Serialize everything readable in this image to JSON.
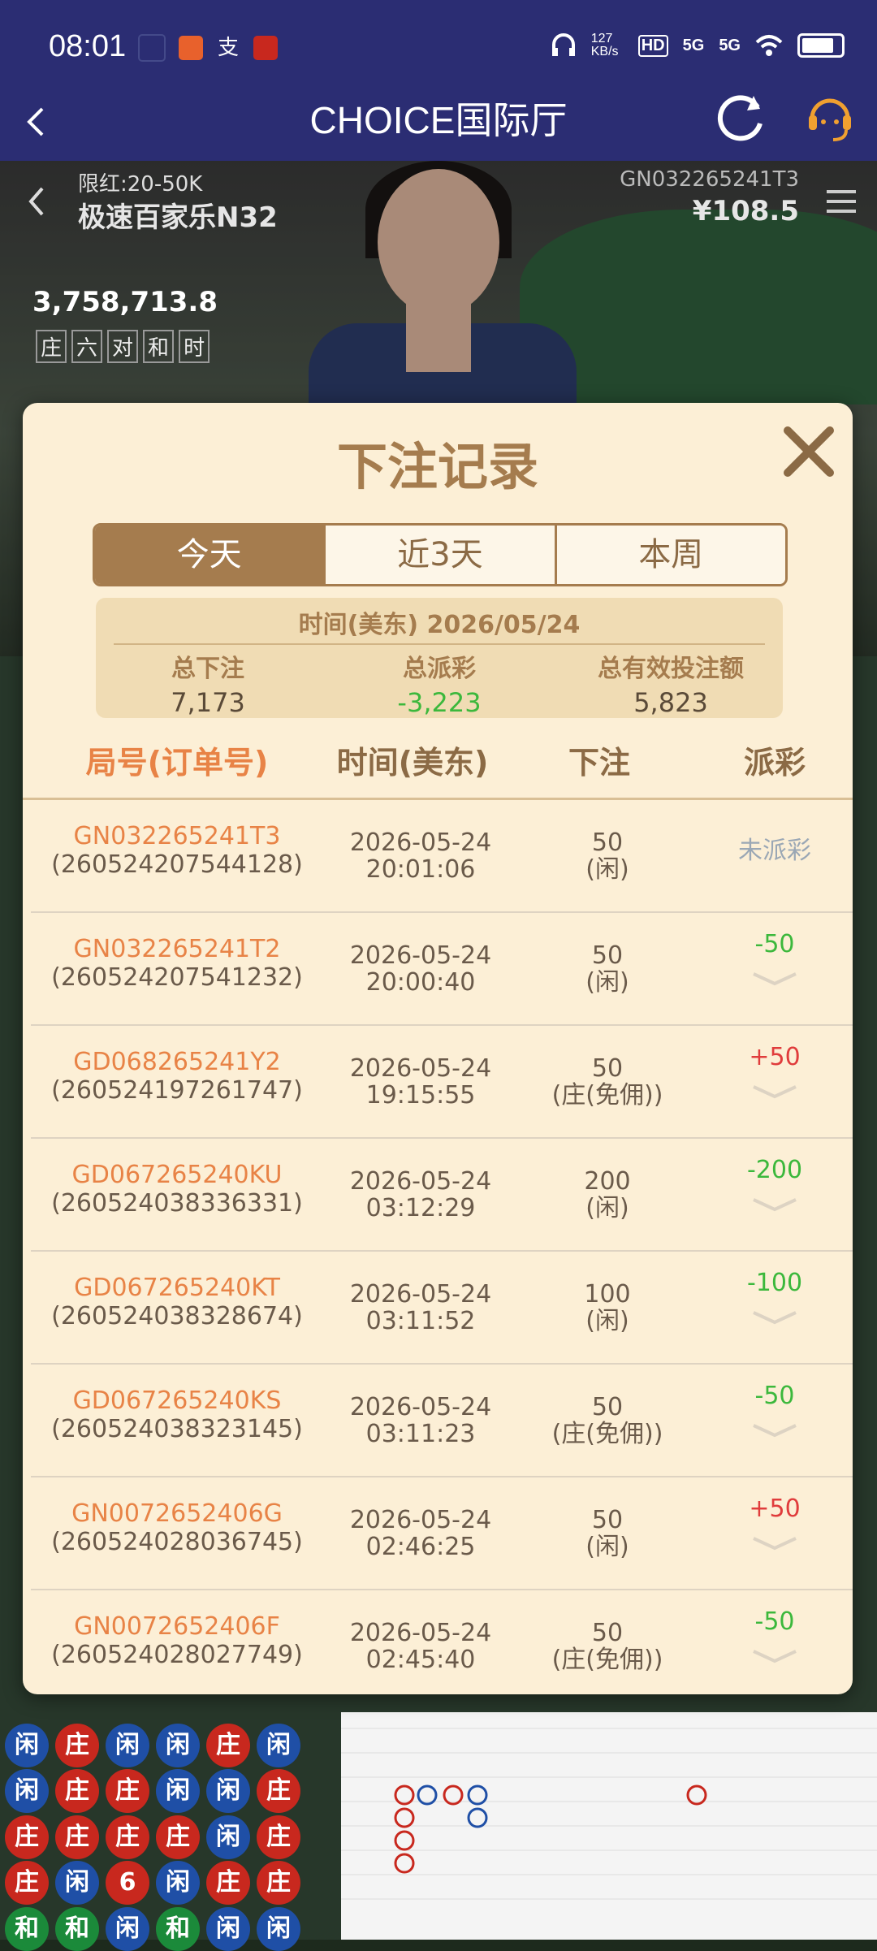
{
  "status_bar": {
    "time": "08:01",
    "net_speed": "127 KB/s",
    "signal1": "5G",
    "signal2": "5G"
  },
  "header": {
    "title": "CHOICE国际厅"
  },
  "video": {
    "limit": "限红:20-50K",
    "table_name": "极速百家乐N32",
    "game_id": "GN032265241T3",
    "balance": "¥108.5",
    "pool": "3,758,713.8",
    "tags": [
      "庄",
      "六",
      "对",
      "和",
      "时"
    ]
  },
  "modal": {
    "title": "下注记录",
    "tabs": [
      "今天",
      "近3天",
      "本周"
    ],
    "active_tab": 0,
    "summary": {
      "date_label": "时间(美东) 2026/05/24",
      "total_bet_label": "总下注",
      "total_bet": "7,173",
      "total_payout_label": "总派彩",
      "total_payout": "-3,223",
      "total_valid_label": "总有效投注额",
      "total_valid": "5,823"
    },
    "columns": [
      "局号(订单号)",
      "时间(美东)",
      "下注",
      "派彩"
    ],
    "rows": [
      {
        "id": "GN032265241T3",
        "order": "(260524207544128)",
        "date": "2026-05-24",
        "time": "20:01:06",
        "amount": "50",
        "side": "(闲)",
        "payout": "未派彩",
        "payout_type": "none"
      },
      {
        "id": "GN032265241T2",
        "order": "(260524207541232)",
        "date": "2026-05-24",
        "time": "20:00:40",
        "amount": "50",
        "side": "(闲)",
        "payout": "-50",
        "payout_type": "neg"
      },
      {
        "id": "GD068265241Y2",
        "order": "(260524197261747)",
        "date": "2026-05-24",
        "time": "19:15:55",
        "amount": "50",
        "side": "(庄(免佣))",
        "payout": "+50",
        "payout_type": "pos"
      },
      {
        "id": "GD067265240KU",
        "order": "(260524038336331)",
        "date": "2026-05-24",
        "time": "03:12:29",
        "amount": "200",
        "side": "(闲)",
        "payout": "-200",
        "payout_type": "neg"
      },
      {
        "id": "GD067265240KT",
        "order": "(260524038328674)",
        "date": "2026-05-24",
        "time": "03:11:52",
        "amount": "100",
        "side": "(闲)",
        "payout": "-100",
        "payout_type": "neg"
      },
      {
        "id": "GD067265240KS",
        "order": "(260524038323145)",
        "date": "2026-05-24",
        "time": "03:11:23",
        "amount": "50",
        "side": "(庄(免佣))",
        "payout": "-50",
        "payout_type": "neg"
      },
      {
        "id": "GN0072652406G",
        "order": "(260524028036745)",
        "date": "2026-05-24",
        "time": "02:46:25",
        "amount": "50",
        "side": "(闲)",
        "payout": "+50",
        "payout_type": "pos"
      },
      {
        "id": "GN0072652406F",
        "order": "(260524028027749)",
        "date": "2026-05-24",
        "time": "02:45:40",
        "amount": "50",
        "side": "(庄(免佣))",
        "payout": "-50",
        "payout_type": "neg"
      }
    ]
  },
  "road": [
    "闲",
    "庄",
    "闲",
    "闲",
    "庄",
    "闲",
    "闲",
    "庄",
    "庄",
    "闲",
    "闲",
    "庄",
    "庄",
    "庄",
    "庄",
    "庄",
    "闲",
    "庄",
    "庄",
    "闲",
    "6",
    "闲",
    "庄",
    "庄",
    "和",
    "和",
    "闲",
    "和",
    "闲",
    "闲"
  ]
}
